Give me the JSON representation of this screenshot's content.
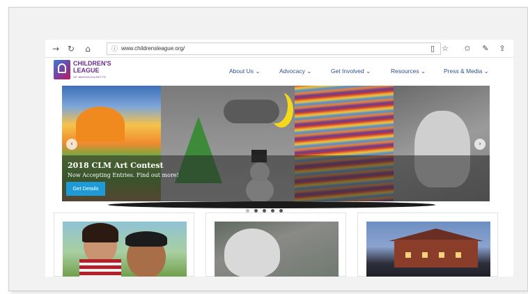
{
  "browser": {
    "url": "www.childrensleague.org/",
    "icons": {
      "back": "back-arrow-icon",
      "reload": "reload-icon",
      "home": "home-icon",
      "info": "info-icon",
      "reading_view": "reading-view-icon",
      "favorite": "star-icon",
      "favorites_list": "favorites-icon",
      "notes": "pen-icon",
      "share": "share-icon"
    }
  },
  "logo": {
    "line1": "CHILDREN'S",
    "line2": "LEAGUE",
    "line3": "OF MASSACHUSETTS"
  },
  "nav": [
    {
      "label": "About Us ⌄"
    },
    {
      "label": "Advocacy ⌄"
    },
    {
      "label": "Get Involved ⌄"
    },
    {
      "label": "Resources ⌄"
    },
    {
      "label": "Press & Media ⌄"
    }
  ],
  "hero": {
    "title": "2018 CLM Art Contest",
    "subtitle": "Now Accepting Entries. Find out more!",
    "button": "Get Details",
    "slide_count": 5,
    "active_slide": 1
  },
  "colors": {
    "brand_purple": "#6a2c91",
    "nav_blue": "#2d4f8f",
    "button_blue": "#1e9bd7"
  }
}
